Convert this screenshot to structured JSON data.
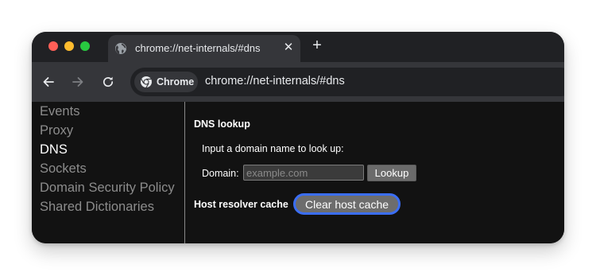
{
  "tab": {
    "title": "chrome://net-internals/#dns",
    "close_glyph": "✕",
    "icon": "globe-icon"
  },
  "new_tab": {
    "glyph": "+"
  },
  "toolbar": {
    "back_icon": "back-arrow-icon",
    "forward_icon": "forward-arrow-icon",
    "reload_icon": "reload-icon",
    "chip_label": "Chrome",
    "chip_icon": "chrome-icon",
    "url": "chrome://net-internals/#dns"
  },
  "sidebar": {
    "items": [
      {
        "label": "Events",
        "active": false
      },
      {
        "label": "Proxy",
        "active": false
      },
      {
        "label": "DNS",
        "active": true
      },
      {
        "label": "Sockets",
        "active": false
      },
      {
        "label": "Domain Security Policy",
        "active": false
      },
      {
        "label": "Shared Dictionaries",
        "active": false
      }
    ]
  },
  "dns": {
    "title": "DNS lookup",
    "prompt": "Input a domain name to look up:",
    "domain_label": "Domain:",
    "domain_placeholder": "example.com",
    "domain_value": "",
    "lookup_label": "Lookup",
    "cache_title": "Host resolver cache",
    "clear_label": "Clear host cache"
  },
  "colors": {
    "focus_ring": "#3b6ef5",
    "page_background": "#121212",
    "tab_strip": "#202124",
    "toolbar": "#35363a"
  }
}
